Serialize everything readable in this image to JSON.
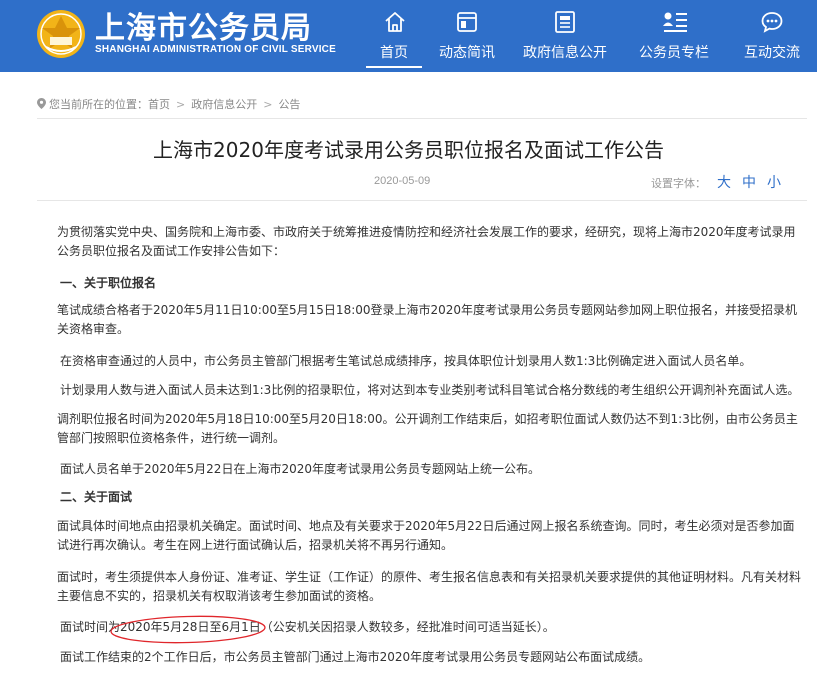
{
  "header": {
    "logo_cn": "上海市公务员局",
    "logo_en": "SHANGHAI ADMINISTRATION OF CIVIL SERVICE",
    "nav": [
      {
        "label": "首页",
        "icon": "home-icon",
        "active": true
      },
      {
        "label": "动态简讯",
        "icon": "window-icon",
        "active": false
      },
      {
        "label": "政府信息公开",
        "icon": "document-icon",
        "active": false
      },
      {
        "label": "公务员专栏",
        "icon": "person-list-icon",
        "active": false
      },
      {
        "label": "互动交流",
        "icon": "chat-icon",
        "active": false
      }
    ]
  },
  "breadcrumb": {
    "prefix": "您当前所在的位置：",
    "items": [
      "首页",
      "政府信息公开",
      "公告"
    ],
    "separator": ">"
  },
  "article": {
    "title": "上海市2020年度考试录用公务员职位报名及面试工作公告",
    "date": "2020-05-09",
    "font_size_label": "设置字体：",
    "font_sizes": [
      "大",
      "中",
      "小"
    ],
    "paragraphs": [
      "为贯彻落实党中央、国务院和上海市委、市政府关于统筹推进疫情防控和经济社会发展工作的要求，经研究，现将上海市2020年度考试录用公务员职位报名及面试工作安排公告如下：",
      "一、关于职位报名",
      "笔试成绩合格者于2020年5月11日10:00至5月15日18:00登录上海市2020年度考试录用公务员专题网站参加网上职位报名，并接受招录机关资格审查。",
      "在资格审查通过的人员中，市公务员主管部门根据考生笔试总成绩排序，按具体职位计划录用人数1:3比例确定进入面试人员名单。",
      "计划录用人数与进入面试人员未达到1:3比例的招录职位，将对达到本专业类别考试科目笔试合格分数线的考生组织公开调剂补充面试人选。",
      "调剂职位报名时间为2020年5月18日10:00至5月20日18:00。公开调剂工作结束后，如招考职位面试人数仍达不到1:3比例，由市公务员主管部门按照职位资格条件，进行统一调剂。",
      "面试人员名单于2020年5月22日在上海市2020年度考试录用公务员专题网站上统一公布。",
      "二、关于面试",
      "面试具体时间地点由招录机关确定。面试时间、地点及有关要求于2020年5月22日后通过网上报名系统查询。同时，考生必须对是否参加面试进行再次确认。考生在网上进行面试确认后，招录机关将不再另行通知。",
      "面试时，考生须提供本人身份证、准考证、学生证（工作证）的原件、考生报名信息表和有关招录机关要求提供的其他证明材料。凡有关材料主要信息不实的，招录机关有权取消该考生参加面试的资格。",
      "面试时间为2020年5月28日至6月1日（公安机关因招录人数较多，经批准时间可适当延长）。",
      "面试工作结束的2个工作日后，市公务员主管部门通过上海市2020年度考试录用公务员专题网站公布面试成绩。"
    ]
  },
  "colors": {
    "header_bg": "#2f6fc9",
    "emblem": "#f2b418",
    "annotation": "#e0262b"
  }
}
